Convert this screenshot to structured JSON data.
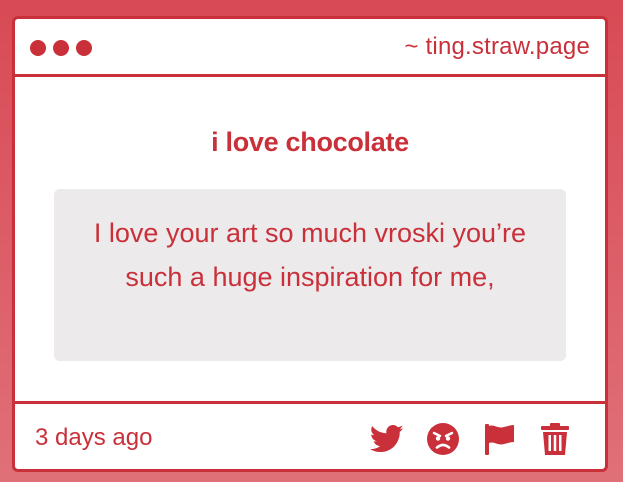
{
  "window": {
    "url_text": "~ ting.straw.page"
  },
  "post": {
    "question": "i love chocolate",
    "message": "I love your art so much vroski you’re such a huge inspiration for me,",
    "timestamp": "3 days ago"
  },
  "actions": {
    "icons": [
      "twitter-icon",
      "angry-face-icon",
      "flag-icon",
      "trash-icon"
    ]
  },
  "colors": {
    "accent": "#c9303a",
    "background_top": "#d84a55",
    "background_bottom": "#e07078",
    "card": "#ffffff",
    "message_box": "#eceaeb"
  }
}
